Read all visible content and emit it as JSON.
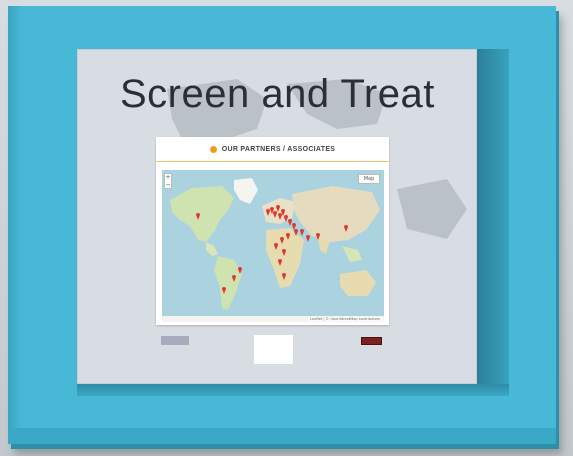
{
  "slide": {
    "title": "Screen and Treat"
  },
  "card": {
    "title": "OUR PARTNERS / ASSOCIATES",
    "dot_color": "#f39a1b"
  },
  "map": {
    "zoom_in": "+",
    "zoom_out": "−",
    "layer_label": "Map",
    "attribution": "Leaflet | © OpenStreetMap contributors",
    "marker_color": "#e03a2f"
  },
  "colors": {
    "frame": "#47b9d6",
    "panel": "#d7dde2",
    "title_text": "#2b2f35"
  }
}
